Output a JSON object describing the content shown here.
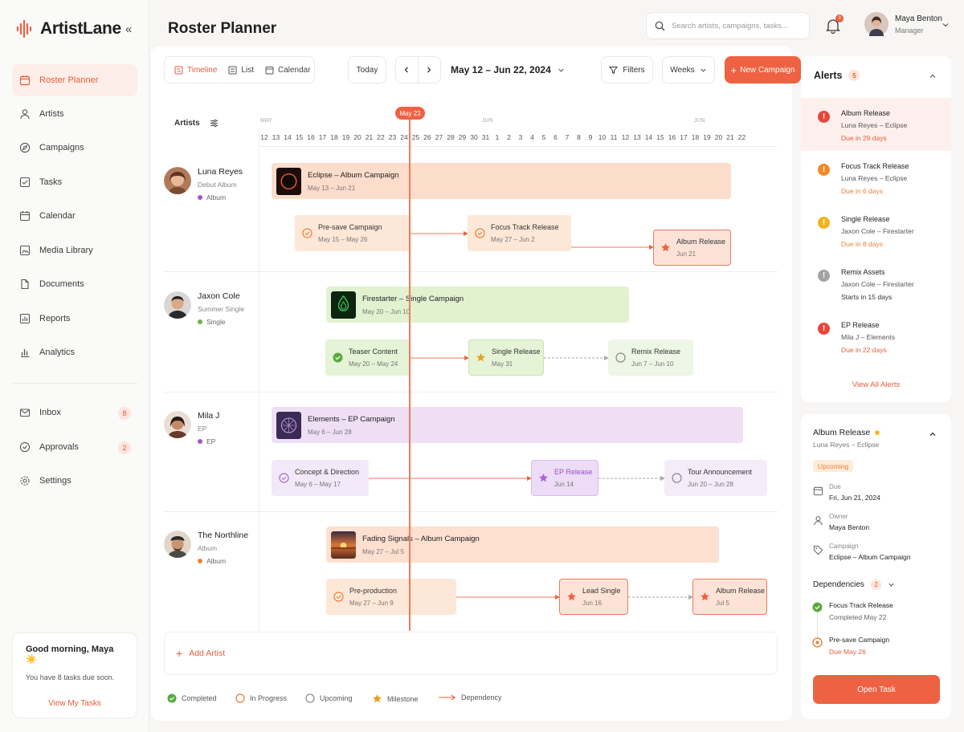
{
  "app": {
    "name": "ArtistLane"
  },
  "sidebar": {
    "items": [
      {
        "label": "Roster Planner",
        "icon": "calendar-check-icon"
      },
      {
        "label": "Artists",
        "icon": "user-icon"
      },
      {
        "label": "Campaigns",
        "icon": "compass-icon"
      },
      {
        "label": "Tasks",
        "icon": "checklist-icon"
      },
      {
        "label": "Calendar",
        "icon": "calendar-icon"
      },
      {
        "label": "Media Library",
        "icon": "media-icon"
      },
      {
        "label": "Documents",
        "icon": "document-icon"
      },
      {
        "label": "Reports",
        "icon": "report-icon"
      },
      {
        "label": "Analytics",
        "icon": "analytics-icon"
      }
    ],
    "secondary": [
      {
        "label": "Inbox",
        "badge": "8",
        "icon": "mail-icon"
      },
      {
        "label": "Approvals",
        "badge": "2",
        "icon": "check-circle-icon"
      },
      {
        "label": "Settings",
        "icon": "gear-icon"
      }
    ],
    "greeting": {
      "title": "Good morning, Maya ☀️",
      "subtitle": "You have 8 tasks due soon.",
      "link": "View My Tasks"
    }
  },
  "header": {
    "title": "Roster Planner",
    "search_placeholder": "Search artists, campaigns, tasks...",
    "notifications": "3",
    "user": {
      "name": "Maya Benton",
      "role": "Manager"
    }
  },
  "toolbar": {
    "views": [
      "Timeline",
      "List",
      "Calendar"
    ],
    "today": "Today",
    "date_range": "May 12 – Jun 22, 2024",
    "filters": "Filters",
    "scale": "Weeks",
    "new_campaign": "New Campaign"
  },
  "timeline": {
    "artists_header": "Artists",
    "today_label": "May 23",
    "months": [
      "MAY",
      "JUN"
    ],
    "days": [
      "12",
      "13",
      "14",
      "15",
      "16",
      "17",
      "18",
      "19",
      "20",
      "21",
      "22",
      "23",
      "24",
      "25",
      "26",
      "27",
      "28",
      "29",
      "30",
      "31",
      "1",
      "2",
      "3",
      "4",
      "5",
      "6",
      "7",
      "8",
      "9",
      "10",
      "11",
      "12",
      "13",
      "14",
      "15",
      "16",
      "17",
      "18",
      "19",
      "20",
      "21",
      "22"
    ],
    "rows": [
      {
        "artist": "Luna Reyes",
        "subtitle": "Debut Album",
        "tag": "Album",
        "tag_color": "#a855c7",
        "campaign": {
          "title": "Eclipse – Album Campaign",
          "dates": "May 13 – Jun 21"
        },
        "tasks": [
          {
            "title": "Pre-save Campaign",
            "dates": "May 15 – May 26",
            "status": "in-progress"
          },
          {
            "title": "Focus Track Release",
            "dates": "May 27 – Jun 2",
            "status": "in-progress"
          },
          {
            "title": "Album Release",
            "dates": "Jun 21",
            "status": "milestone"
          }
        ]
      },
      {
        "artist": "Jaxon Cole",
        "subtitle": "Summer Single",
        "tag": "Single",
        "tag_color": "#6bb24a",
        "campaign": {
          "title": "Firestarter – Single Campaign",
          "dates": "May 20 – Jun 10"
        },
        "tasks": [
          {
            "title": "Teaser Content",
            "dates": "May 20 – May 24",
            "status": "completed"
          },
          {
            "title": "Single Release",
            "dates": "May 31",
            "status": "milestone"
          },
          {
            "title": "Remix Release",
            "dates": "Jun 7 – Jun 10",
            "status": "upcoming"
          }
        ]
      },
      {
        "artist": "Mila J",
        "subtitle": "EP",
        "tag": "EP",
        "tag_color": "#9b59c9",
        "campaign": {
          "title": "Elements – EP Campaign",
          "dates": "May 6 – Jun 28"
        },
        "tasks": [
          {
            "title": "Concept & Direction",
            "dates": "May 6 – May 17",
            "status": "in-progress"
          },
          {
            "title": "EP Release",
            "dates": "Jun 14",
            "status": "milestone"
          },
          {
            "title": "Tour Announcement",
            "dates": "Jun 20 – Jun 28",
            "status": "upcoming"
          }
        ]
      },
      {
        "artist": "The Northline",
        "subtitle": "Album",
        "tag": "Album",
        "tag_color": "#e8823a",
        "campaign": {
          "title": "Fading Signals – Album Campaign",
          "dates": "May 27 – Jul 5"
        },
        "tasks": [
          {
            "title": "Pre-production",
            "dates": "May 27 – Jun 9",
            "status": "in-progress"
          },
          {
            "title": "Lead Single",
            "dates": "Jun 16",
            "status": "milestone"
          },
          {
            "title": "Album Release",
            "dates": "Jul 5",
            "status": "milestone"
          }
        ]
      }
    ],
    "add_artist": "Add Artist"
  },
  "legend": [
    "Completed",
    "In Progress",
    "Upcoming",
    "Milestone",
    "Dependency"
  ],
  "alerts": {
    "title": "Alerts",
    "count": "5",
    "items": [
      {
        "title": "Album Release",
        "subtitle": "Luna Reyes – Eclipse",
        "due": "Due in 29 days",
        "color": "#e5473a"
      },
      {
        "title": "Focus Track Release",
        "subtitle": "Luna Reyes – Eclipse",
        "due": "Due in 6 days",
        "color": "#ef8a26"
      },
      {
        "title": "Single Release",
        "subtitle": "Jaxon Cole – Firestarter",
        "due": "Due in 8 days",
        "color": "#f2b31f"
      },
      {
        "title": "Remix Assets",
        "subtitle": "Jaxon Cole – Firestarter",
        "due": "Starts in 15 days",
        "color": "#a3a3a3"
      },
      {
        "title": "EP Release",
        "subtitle": "Mila J – Elements",
        "due": "Due in 22 days",
        "color": "#e5473a"
      }
    ],
    "view_all": "View All Alerts"
  },
  "detail": {
    "title": "Album Release",
    "subtitle": "Luna Reyes – Eclipse",
    "status": "Upcoming",
    "due_label": "Due",
    "due_value": "Fri, Jun 21, 2024",
    "owner_label": "Owner",
    "owner_value": "Maya Benton",
    "campaign_label": "Campaign",
    "campaign_value": "Eclipse – Album Campaign",
    "dependencies_label": "Dependencies",
    "dependencies_count": "2",
    "dependencies": [
      {
        "title": "Focus Track Release",
        "status": "Completed May 22"
      },
      {
        "title": "Pre-save Campaign",
        "status": "Due May 26"
      }
    ],
    "open_task": "Open Task"
  }
}
